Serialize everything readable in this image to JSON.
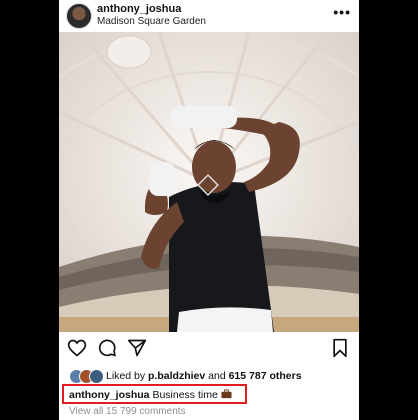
{
  "header": {
    "username": "anthony_joshua",
    "location": "Madison Square Garden",
    "more_icon": "more-dots-icon"
  },
  "photo": {
    "subject": "boxer shadow boxing in arena",
    "colors": {
      "wall": "#efe8e3",
      "shirt": "#16181c",
      "skin": "#6b4330",
      "wraps": "#f2f2f2"
    }
  },
  "actions": {
    "like_icon": "heart-icon",
    "comment_icon": "comment-icon",
    "share_icon": "send-icon",
    "save_icon": "bookmark-icon"
  },
  "likes": {
    "prefix": "Liked by",
    "user": "p.baldzhiev",
    "conjunction": "and",
    "count_text": "615 787 others"
  },
  "caption": {
    "username": "anthony_joshua",
    "text": "Business time",
    "emoji": "briefcase"
  },
  "comments_link": "View all 15 799 comments",
  "highlight_color": "#e11d1d"
}
